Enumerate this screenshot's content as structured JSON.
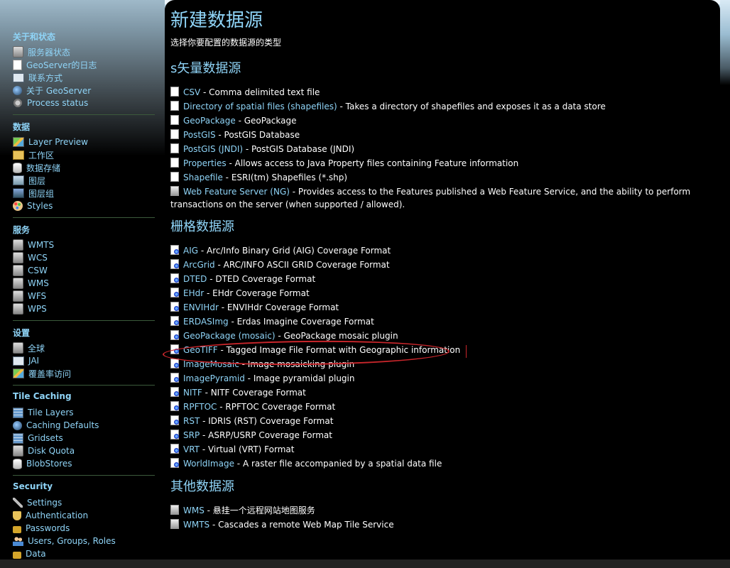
{
  "sidebar": {
    "sections": [
      {
        "title": "关于和状态",
        "items": [
          {
            "label": "服务器状态",
            "icon": "server-status-icon"
          },
          {
            "label": "GeoServer的日志",
            "icon": "log-icon"
          },
          {
            "label": "联系方式",
            "icon": "contact-icon"
          },
          {
            "label": "关于 GeoServer",
            "icon": "about-icon"
          },
          {
            "label": "Process status",
            "icon": "gear-icon"
          }
        ]
      },
      {
        "title": "数据",
        "items": [
          {
            "label": "Layer Preview",
            "icon": "map-icon"
          },
          {
            "label": "工作区",
            "icon": "folder-icon"
          },
          {
            "label": "数据存储",
            "icon": "database-icon"
          },
          {
            "label": "图层",
            "icon": "layer-icon"
          },
          {
            "label": "图层组",
            "icon": "layer-group-icon"
          },
          {
            "label": "Styles",
            "icon": "palette-icon"
          }
        ]
      },
      {
        "title": "服务",
        "items": [
          {
            "label": "WMTS",
            "icon": "service-icon"
          },
          {
            "label": "WCS",
            "icon": "service-icon"
          },
          {
            "label": "CSW",
            "icon": "service-icon"
          },
          {
            "label": "WMS",
            "icon": "service-icon"
          },
          {
            "label": "WFS",
            "icon": "service-icon"
          },
          {
            "label": "WPS",
            "icon": "service-icon"
          }
        ]
      },
      {
        "title": "设置",
        "items": [
          {
            "label": "全球",
            "icon": "server-icon"
          },
          {
            "label": "JAI",
            "icon": "jai-icon"
          },
          {
            "label": "覆盖率访问",
            "icon": "coverage-icon"
          }
        ]
      },
      {
        "title": "Tile Caching",
        "items": [
          {
            "label": "Tile Layers",
            "icon": "grid-icon"
          },
          {
            "label": "Caching Defaults",
            "icon": "globe-icon"
          },
          {
            "label": "Gridsets",
            "icon": "grid-icon"
          },
          {
            "label": "Disk Quota",
            "icon": "disk-icon"
          },
          {
            "label": "BlobStores",
            "icon": "database-icon"
          }
        ]
      },
      {
        "title": "Security",
        "items": [
          {
            "label": "Settings",
            "icon": "wrench-icon"
          },
          {
            "label": "Authentication",
            "icon": "shield-icon"
          },
          {
            "label": "Passwords",
            "icon": "lock-icon"
          },
          {
            "label": "Users, Groups, Roles",
            "icon": "users-icon"
          },
          {
            "label": "Data",
            "icon": "data-lock-icon"
          }
        ]
      }
    ]
  },
  "main": {
    "title": "新建数据源",
    "subtitle": "选择你要配置的数据源的类型",
    "vector_heading": "s矢量数据源",
    "vector": [
      {
        "link": "CSV",
        "desc": " - Comma delimited text file"
      },
      {
        "link": "Directory of spatial files (shapefiles)",
        "desc": " - Takes a directory of shapefiles and exposes it as a data store"
      },
      {
        "link": "GeoPackage",
        "desc": " - GeoPackage"
      },
      {
        "link": "PostGIS",
        "desc": " - PostGIS Database"
      },
      {
        "link": "PostGIS (JNDI)",
        "desc": " - PostGIS Database (JNDI)"
      },
      {
        "link": "Properties",
        "desc": " - Allows access to Java Property files containing Feature information"
      },
      {
        "link": "Shapefile",
        "desc": " - ESRI(tm) Shapefiles (*.shp)"
      },
      {
        "link": "Web Feature Server (NG)",
        "desc": " - Provides access to the Features published a Web Feature Service, and the ability to perform transactions on the server (when supported / allowed)."
      }
    ],
    "raster_heading": "栅格数据源",
    "raster": [
      {
        "link": "AIG",
        "desc": " - Arc/Info Binary Grid (AIG) Coverage Format"
      },
      {
        "link": "ArcGrid",
        "desc": " - ARC/INFO ASCII GRID Coverage Format"
      },
      {
        "link": "DTED",
        "desc": " - DTED Coverage Format"
      },
      {
        "link": "EHdr",
        "desc": " - EHdr Coverage Format"
      },
      {
        "link": "ENVIHdr",
        "desc": " - ENVIHdr Coverage Format"
      },
      {
        "link": "ERDASImg",
        "desc": " - Erdas Imagine Coverage Format"
      },
      {
        "link": "GeoPackage (mosaic)",
        "desc": " - GeoPackage mosaic plugin"
      },
      {
        "link": "GeoTIFF",
        "desc": " - Tagged Image File Format with Geographic information"
      },
      {
        "link": "ImageMosaic",
        "desc": " - Image mosaicking plugin"
      },
      {
        "link": "ImagePyramid",
        "desc": " - Image pyramidal plugin"
      },
      {
        "link": "NITF",
        "desc": " - NITF Coverage Format"
      },
      {
        "link": "RPFTOC",
        "desc": " - RPFTOC Coverage Format"
      },
      {
        "link": "RST",
        "desc": " - IDRIS (RST) Coverage Format"
      },
      {
        "link": "SRP",
        "desc": " - ASRP/USRP Coverage Format"
      },
      {
        "link": "VRT",
        "desc": " - Virtual (VRT) Format"
      },
      {
        "link": "WorldImage",
        "desc": " - A raster file accompanied by a spatial data file"
      }
    ],
    "other_heading": "其他数据源",
    "other": [
      {
        "link": "WMS",
        "desc": " - 悬挂一个远程网站地图服务"
      },
      {
        "link": "WMTS",
        "desc": " - Cascades a remote Web Map Tile Service"
      }
    ]
  },
  "colors": {
    "link": "#8fd4f7",
    "annotation": "#c8262b",
    "background": "#000000"
  }
}
